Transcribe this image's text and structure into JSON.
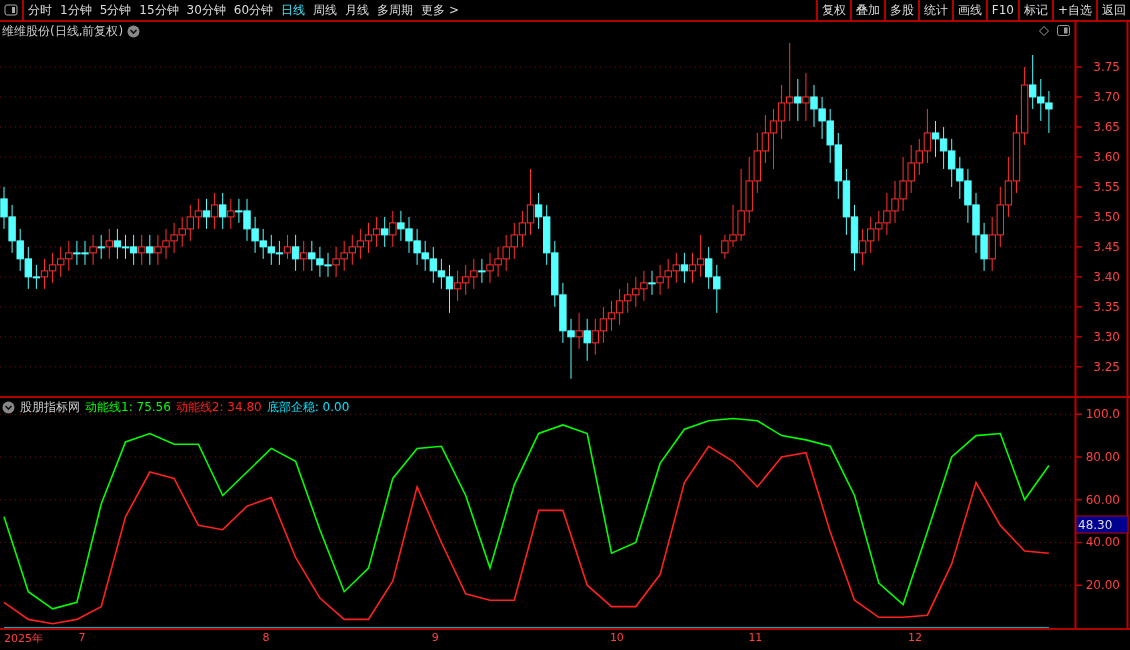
{
  "toolbar": {
    "tabs": [
      {
        "label": "分时",
        "selected": false
      },
      {
        "label": "1分钟",
        "selected": false
      },
      {
        "label": "5分钟",
        "selected": false
      },
      {
        "label": "15分钟",
        "selected": false
      },
      {
        "label": "30分钟",
        "selected": false
      },
      {
        "label": "60分钟",
        "selected": false
      },
      {
        "label": "日线",
        "selected": true
      },
      {
        "label": "周线",
        "selected": false
      },
      {
        "label": "月线",
        "selected": false
      },
      {
        "label": "多周期",
        "selected": false
      },
      {
        "label": "更多 >",
        "selected": false
      }
    ],
    "buttons": [
      "复权",
      "叠加",
      "多股",
      "统计",
      "画线",
      "F10",
      "标记",
      "+自选",
      "返回"
    ]
  },
  "price_panel": {
    "title": "维维股份(日线,前复权)",
    "chart_data": {
      "type": "candlestick",
      "grid": true,
      "ylim": [
        3.198,
        3.825
      ],
      "yticks": [
        {
          "value": 3.75,
          "label": "3.75"
        },
        {
          "value": 3.7,
          "label": "3.70"
        },
        {
          "value": 3.65,
          "label": "3.65"
        },
        {
          "value": 3.6,
          "label": "3.60"
        },
        {
          "value": 3.55,
          "label": "3.55"
        },
        {
          "value": 3.5,
          "label": "3.50"
        },
        {
          "value": 3.45,
          "label": "3.45"
        },
        {
          "value": 3.4,
          "label": "3.40"
        },
        {
          "value": 3.35,
          "label": "3.35"
        },
        {
          "value": 3.3,
          "label": "3.30"
        },
        {
          "value": 3.25,
          "label": "3.25"
        }
      ],
      "ohlc": [
        [
          3.53,
          3.55,
          3.48,
          3.5
        ],
        [
          3.5,
          3.52,
          3.44,
          3.46
        ],
        [
          3.46,
          3.48,
          3.41,
          3.43
        ],
        [
          3.43,
          3.45,
          3.38,
          3.4
        ],
        [
          3.4,
          3.42,
          3.38,
          3.4
        ],
        [
          3.4,
          3.43,
          3.38,
          3.41
        ],
        [
          3.41,
          3.44,
          3.39,
          3.42
        ],
        [
          3.42,
          3.45,
          3.4,
          3.43
        ],
        [
          3.43,
          3.46,
          3.41,
          3.44
        ],
        [
          3.44,
          3.46,
          3.42,
          3.44
        ],
        [
          3.44,
          3.46,
          3.42,
          3.44
        ],
        [
          3.44,
          3.47,
          3.42,
          3.45
        ],
        [
          3.45,
          3.47,
          3.43,
          3.45
        ],
        [
          3.45,
          3.48,
          3.43,
          3.46
        ],
        [
          3.46,
          3.48,
          3.43,
          3.45
        ],
        [
          3.45,
          3.47,
          3.43,
          3.45
        ],
        [
          3.45,
          3.47,
          3.42,
          3.44
        ],
        [
          3.44,
          3.47,
          3.42,
          3.45
        ],
        [
          3.45,
          3.47,
          3.42,
          3.44
        ],
        [
          3.44,
          3.47,
          3.42,
          3.45
        ],
        [
          3.45,
          3.48,
          3.43,
          3.46
        ],
        [
          3.46,
          3.49,
          3.44,
          3.47
        ],
        [
          3.47,
          3.5,
          3.45,
          3.48
        ],
        [
          3.48,
          3.52,
          3.46,
          3.5
        ],
        [
          3.5,
          3.53,
          3.48,
          3.51
        ],
        [
          3.51,
          3.53,
          3.48,
          3.5
        ],
        [
          3.5,
          3.54,
          3.48,
          3.52
        ],
        [
          3.52,
          3.54,
          3.48,
          3.5
        ],
        [
          3.5,
          3.53,
          3.48,
          3.51
        ],
        [
          3.51,
          3.53,
          3.49,
          3.51
        ],
        [
          3.51,
          3.53,
          3.46,
          3.48
        ],
        [
          3.48,
          3.5,
          3.44,
          3.46
        ],
        [
          3.46,
          3.48,
          3.43,
          3.45
        ],
        [
          3.45,
          3.47,
          3.42,
          3.44
        ],
        [
          3.44,
          3.46,
          3.42,
          3.44
        ],
        [
          3.44,
          3.47,
          3.43,
          3.45
        ],
        [
          3.45,
          3.47,
          3.41,
          3.43
        ],
        [
          3.43,
          3.46,
          3.41,
          3.44
        ],
        [
          3.44,
          3.46,
          3.41,
          3.43
        ],
        [
          3.43,
          3.45,
          3.4,
          3.42
        ],
        [
          3.42,
          3.44,
          3.4,
          3.42
        ],
        [
          3.42,
          3.45,
          3.4,
          3.43
        ],
        [
          3.43,
          3.46,
          3.41,
          3.44
        ],
        [
          3.44,
          3.47,
          3.42,
          3.45
        ],
        [
          3.45,
          3.48,
          3.43,
          3.46
        ],
        [
          3.46,
          3.49,
          3.44,
          3.47
        ],
        [
          3.47,
          3.5,
          3.45,
          3.48
        ],
        [
          3.48,
          3.5,
          3.45,
          3.47
        ],
        [
          3.47,
          3.51,
          3.45,
          3.49
        ],
        [
          3.49,
          3.51,
          3.46,
          3.48
        ],
        [
          3.48,
          3.5,
          3.44,
          3.46
        ],
        [
          3.46,
          3.48,
          3.42,
          3.44
        ],
        [
          3.44,
          3.46,
          3.41,
          3.43
        ],
        [
          3.43,
          3.45,
          3.39,
          3.41
        ],
        [
          3.41,
          3.43,
          3.38,
          3.4
        ],
        [
          3.4,
          3.42,
          3.34,
          3.38
        ],
        [
          3.38,
          3.41,
          3.36,
          3.39
        ],
        [
          3.39,
          3.42,
          3.37,
          3.4
        ],
        [
          3.4,
          3.43,
          3.38,
          3.41
        ],
        [
          3.41,
          3.43,
          3.39,
          3.41
        ],
        [
          3.41,
          3.44,
          3.39,
          3.42
        ],
        [
          3.42,
          3.45,
          3.4,
          3.43
        ],
        [
          3.43,
          3.47,
          3.41,
          3.45
        ],
        [
          3.45,
          3.49,
          3.43,
          3.47
        ],
        [
          3.47,
          3.51,
          3.45,
          3.49
        ],
        [
          3.49,
          3.58,
          3.47,
          3.52
        ],
        [
          3.52,
          3.54,
          3.48,
          3.5
        ],
        [
          3.5,
          3.52,
          3.42,
          3.44
        ],
        [
          3.44,
          3.46,
          3.35,
          3.37
        ],
        [
          3.37,
          3.39,
          3.29,
          3.31
        ],
        [
          3.31,
          3.33,
          3.23,
          3.3
        ],
        [
          3.3,
          3.34,
          3.28,
          3.31
        ],
        [
          3.31,
          3.33,
          3.26,
          3.29
        ],
        [
          3.29,
          3.33,
          3.27,
          3.31
        ],
        [
          3.31,
          3.35,
          3.29,
          3.33
        ],
        [
          3.33,
          3.36,
          3.31,
          3.34
        ],
        [
          3.34,
          3.38,
          3.32,
          3.36
        ],
        [
          3.36,
          3.39,
          3.34,
          3.37
        ],
        [
          3.37,
          3.4,
          3.35,
          3.38
        ],
        [
          3.38,
          3.41,
          3.36,
          3.39
        ],
        [
          3.39,
          3.41,
          3.37,
          3.39
        ],
        [
          3.39,
          3.42,
          3.37,
          3.4
        ],
        [
          3.4,
          3.43,
          3.38,
          3.41
        ],
        [
          3.41,
          3.44,
          3.39,
          3.42
        ],
        [
          3.42,
          3.44,
          3.39,
          3.41
        ],
        [
          3.41,
          3.44,
          3.39,
          3.42
        ],
        [
          3.42,
          3.47,
          3.4,
          3.43
        ],
        [
          3.43,
          3.45,
          3.38,
          3.4
        ],
        [
          3.4,
          3.42,
          3.34,
          3.38
        ],
        [
          3.44,
          3.47,
          3.43,
          3.46
        ],
        [
          3.46,
          3.52,
          3.45,
          3.47
        ],
        [
          3.47,
          3.58,
          3.46,
          3.51
        ],
        [
          3.51,
          3.6,
          3.49,
          3.56
        ],
        [
          3.56,
          3.64,
          3.54,
          3.61
        ],
        [
          3.61,
          3.67,
          3.59,
          3.64
        ],
        [
          3.64,
          3.68,
          3.58,
          3.66
        ],
        [
          3.66,
          3.72,
          3.63,
          3.69
        ],
        [
          3.69,
          3.79,
          3.66,
          3.7
        ],
        [
          3.7,
          3.73,
          3.66,
          3.69
        ],
        [
          3.69,
          3.74,
          3.66,
          3.7
        ],
        [
          3.7,
          3.72,
          3.65,
          3.68
        ],
        [
          3.68,
          3.7,
          3.63,
          3.66
        ],
        [
          3.66,
          3.68,
          3.59,
          3.62
        ],
        [
          3.62,
          3.64,
          3.53,
          3.56
        ],
        [
          3.56,
          3.58,
          3.47,
          3.5
        ],
        [
          3.5,
          3.52,
          3.41,
          3.44
        ],
        [
          3.44,
          3.48,
          3.42,
          3.46
        ],
        [
          3.46,
          3.5,
          3.44,
          3.48
        ],
        [
          3.48,
          3.51,
          3.46,
          3.49
        ],
        [
          3.49,
          3.54,
          3.47,
          3.51
        ],
        [
          3.51,
          3.56,
          3.49,
          3.53
        ],
        [
          3.53,
          3.6,
          3.51,
          3.56
        ],
        [
          3.56,
          3.62,
          3.54,
          3.59
        ],
        [
          3.59,
          3.63,
          3.57,
          3.61
        ],
        [
          3.61,
          3.68,
          3.59,
          3.64
        ],
        [
          3.64,
          3.66,
          3.6,
          3.63
        ],
        [
          3.63,
          3.65,
          3.58,
          3.61
        ],
        [
          3.61,
          3.63,
          3.55,
          3.58
        ],
        [
          3.58,
          3.6,
          3.53,
          3.56
        ],
        [
          3.56,
          3.58,
          3.49,
          3.52
        ],
        [
          3.52,
          3.54,
          3.44,
          3.47
        ],
        [
          3.47,
          3.49,
          3.41,
          3.43
        ],
        [
          3.43,
          3.5,
          3.41,
          3.47
        ],
        [
          3.47,
          3.55,
          3.45,
          3.52
        ],
        [
          3.52,
          3.6,
          3.5,
          3.56
        ],
        [
          3.56,
          3.67,
          3.54,
          3.64
        ],
        [
          3.64,
          3.75,
          3.62,
          3.72
        ],
        [
          3.72,
          3.77,
          3.68,
          3.7
        ],
        [
          3.7,
          3.73,
          3.66,
          3.69
        ],
        [
          3.69,
          3.71,
          3.64,
          3.68
        ]
      ]
    }
  },
  "indicator_panel": {
    "name": "股朋指标网",
    "legend": [
      {
        "text": "动能线1: 75.56",
        "color": "#00ff00"
      },
      {
        "text": "动能线2: 34.80",
        "color": "#ff2020"
      },
      {
        "text": "底部企稳: 0.00",
        "color": "#00e5ff"
      }
    ],
    "cursor_label": "48.30",
    "chart_data": {
      "type": "line",
      "grid": true,
      "ylim": [
        0,
        107.6
      ],
      "yticks": [
        {
          "value": 20,
          "label": "20.00"
        },
        {
          "value": 40,
          "label": "40.00"
        },
        {
          "value": 60,
          "label": "60.00"
        },
        {
          "value": 80,
          "label": "80.00"
        },
        {
          "value": 100,
          "label": "100.0"
        }
      ],
      "series": [
        {
          "color": "#00ff00",
          "values": [
            52,
            17,
            9,
            12,
            58,
            87,
            91,
            86,
            86,
            62,
            73,
            84,
            78,
            46,
            17,
            28,
            70,
            84,
            85,
            62,
            28,
            67,
            91,
            95,
            91,
            35,
            40,
            77,
            93,
            97,
            98,
            97,
            90,
            88,
            85,
            62,
            21,
            11,
            45,
            80,
            90,
            91,
            60,
            76
          ]
        },
        {
          "color": "#ff2020",
          "values": [
            12,
            4,
            2,
            4,
            10,
            52,
            73,
            70,
            48,
            46,
            57,
            61,
            33,
            14,
            4,
            4,
            22,
            66,
            40,
            16,
            13,
            13,
            55,
            55,
            20,
            10,
            10,
            25,
            68,
            85,
            78,
            66,
            80,
            82,
            45,
            13,
            5,
            5,
            6,
            30,
            68,
            48,
            36,
            35
          ]
        },
        {
          "color": "#00e5ff",
          "values": [
            0,
            0,
            0,
            0,
            0,
            0,
            0,
            0,
            0,
            0,
            0,
            0,
            0,
            0,
            0,
            0,
            0,
            0,
            0,
            0,
            0,
            0,
            0,
            0,
            0,
            0,
            0,
            0,
            0,
            0,
            0,
            0,
            0,
            0,
            0,
            0,
            0,
            0,
            0,
            0,
            0,
            0,
            0,
            0
          ]
        }
      ]
    }
  },
  "date_axis": [
    "2025年",
    "7",
    "8",
    "9",
    "10",
    "11",
    "12"
  ]
}
